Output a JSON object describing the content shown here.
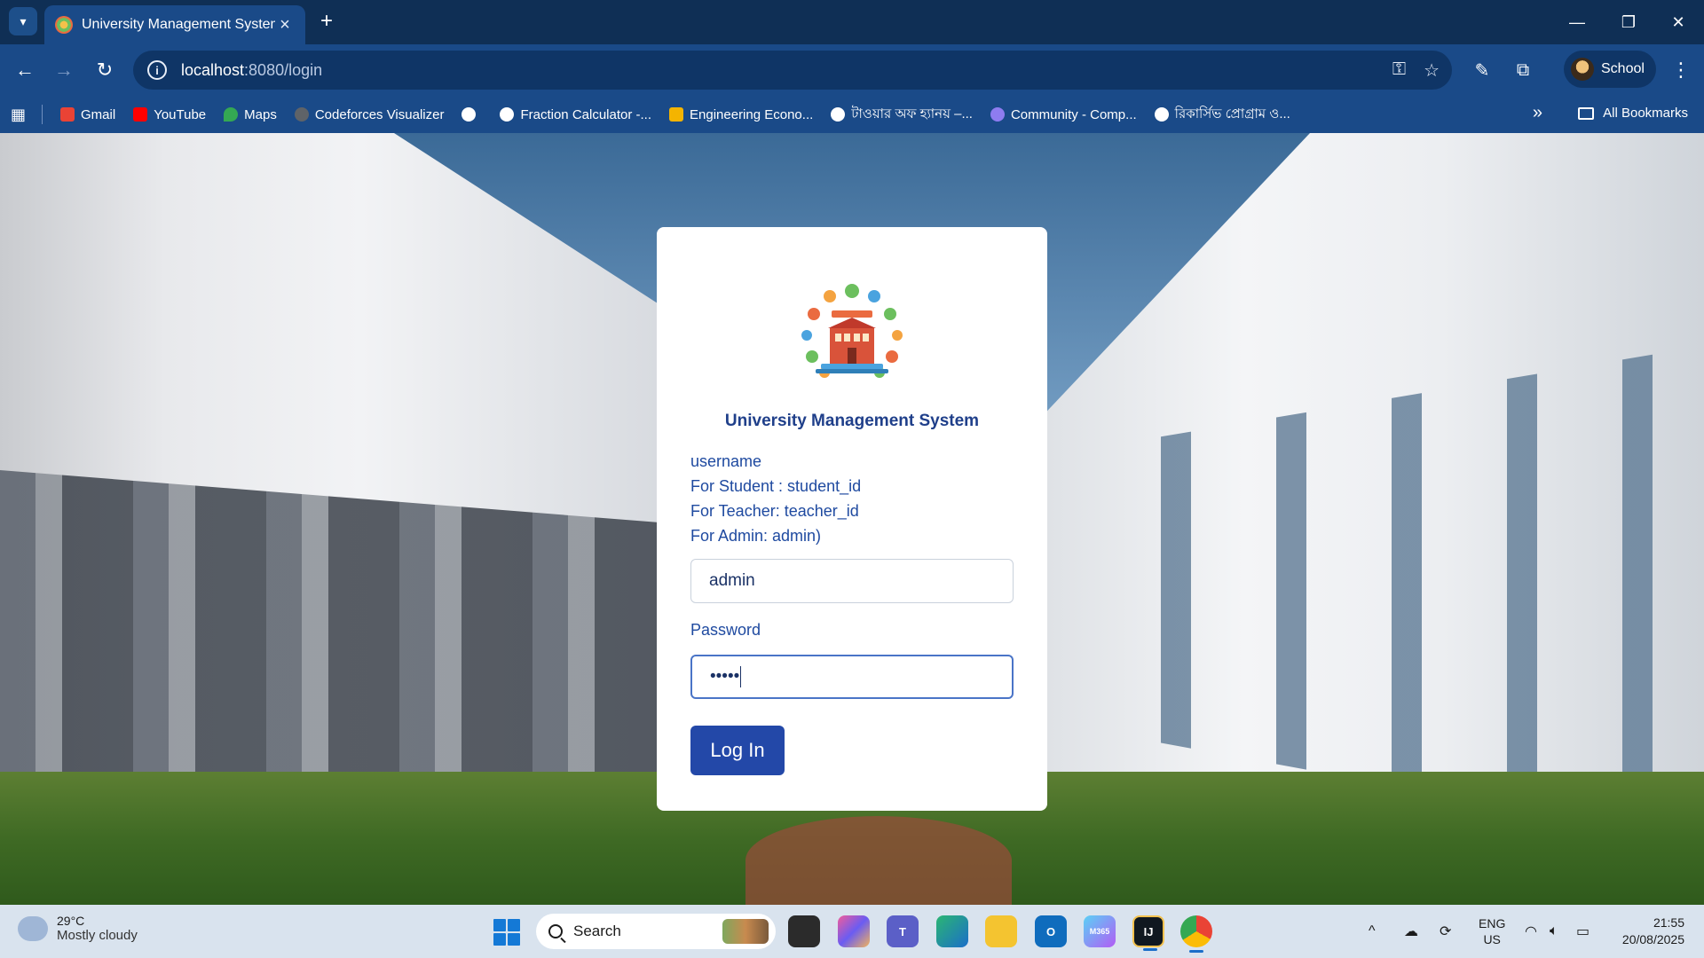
{
  "browser": {
    "tab_title": "University Management System",
    "url_host": "localhost",
    "url_path": ":8080/login",
    "profile_name": "School",
    "bookmarks": [
      {
        "label": "Gmail",
        "color": "#ea4335"
      },
      {
        "label": "YouTube",
        "color": "#ff0000"
      },
      {
        "label": "Maps",
        "color": "#34a853"
      },
      {
        "label": "Codeforces Visualizer",
        "color": "#5f6368"
      },
      {
        "label": "",
        "color": "#ffffff"
      },
      {
        "label": "Fraction Calculator -...",
        "color": "#ffffff"
      },
      {
        "label": "Engineering Econo...",
        "color": "#f4b400"
      },
      {
        "label": "টাওয়ার অফ হ্যানয় –...",
        "color": "#ffffff"
      },
      {
        "label": "Community - Comp...",
        "color": "#8e7cf0"
      },
      {
        "label": "রিকার্সিভ প্রোগ্রাম ও...",
        "color": "#ffffff"
      }
    ],
    "all_bookmarks": "All Bookmarks"
  },
  "login": {
    "title": "University Management System",
    "hint_lines": [
      "username",
      "For Student : student_id",
      "For Teacher: teacher_id",
      "For Admin: admin)"
    ],
    "username_value": "admin",
    "password_label": "Password",
    "password_value": "•••••",
    "login_button": "Log In"
  },
  "taskbar": {
    "temperature": "29°C",
    "weather": "Mostly cloudy",
    "search_placeholder": "Search",
    "lang_1": "ENG",
    "lang_2": "US",
    "time": "21:55",
    "date": "20/08/2025",
    "app_m365_label": "M365"
  },
  "colors": {
    "accent": "#2348a8",
    "title": "#1f3f8a",
    "chrome": "#1a4a88"
  }
}
